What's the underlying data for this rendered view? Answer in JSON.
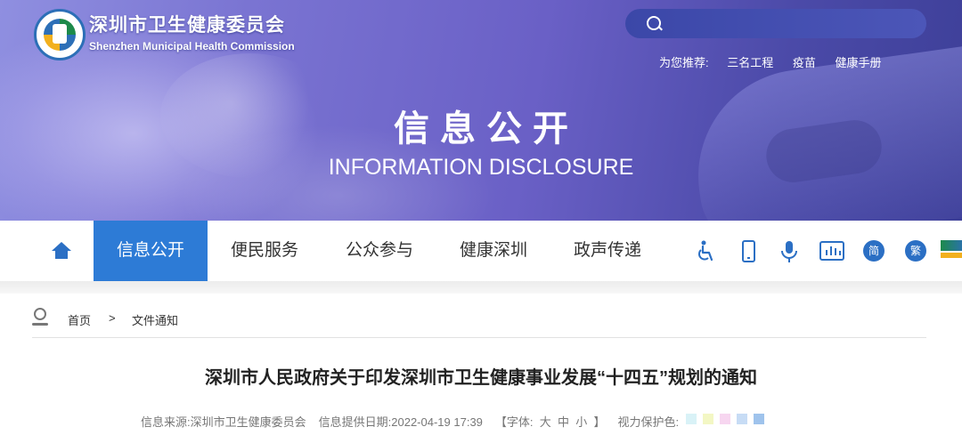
{
  "header": {
    "org_name_cn": "深圳市卫生健康委员会",
    "org_name_en": "Shenzhen Municipal Health Commission",
    "logo_icon": "szhc-logo-icon",
    "search": {
      "placeholder": "",
      "icon": "search-icon"
    },
    "recommend": {
      "label": "为您推荐:",
      "links": [
        "三名工程",
        "疫苗",
        "健康手册"
      ]
    },
    "banner_title": "信息公开",
    "banner_subtitle": "INFORMATION DISCLOSURE"
  },
  "nav": {
    "home_icon": "home-icon",
    "items": [
      "信息公开",
      "便民服务",
      "公众参与",
      "健康深圳",
      "政声传递"
    ],
    "active_index": 0,
    "tools": {
      "accessibility_icon": "accessibility-icon",
      "mobile_icon": "mobile-icon",
      "voice_icon": "microphone-icon",
      "data_icon": "chart-icon",
      "simplified": "简",
      "traditional": "繁"
    }
  },
  "breadcrumb": {
    "icon": "location-icon",
    "home": "首页",
    "separator": ">",
    "current": "文件通知"
  },
  "article": {
    "title": "深圳市人民政府关于印发深圳市卫生健康事业发展“十四五”规划的通知",
    "source_label": "信息来源:",
    "source": "深圳市卫生健康委员会",
    "date_label": "信息提供日期:",
    "date": "2022-04-19 17:39",
    "font_label": "【字体:",
    "font_large": "大",
    "font_medium": "中",
    "font_small": "小",
    "font_close": "】",
    "eye_care_label": "视力保护色:",
    "eye_care_colors": [
      "#d9f2f7",
      "#f3f7c4",
      "#f7d6f0",
      "#c7dcf5",
      "#9fc3ec"
    ]
  },
  "colors": {
    "accent": "#2d7bd6",
    "icon_blue": "#2b6fc4"
  }
}
